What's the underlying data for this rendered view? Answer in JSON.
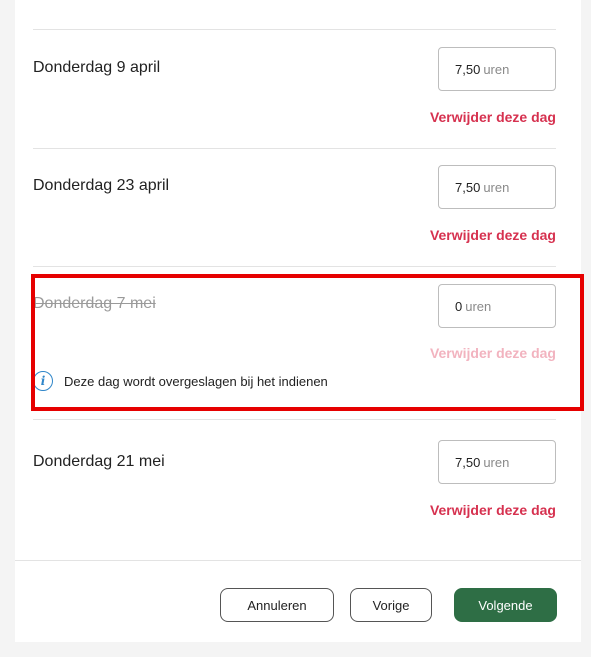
{
  "days": [
    {
      "label": "Donderdag 9 april",
      "hours_value": "7,50",
      "hours_unit": "uren",
      "remove_label": "Verwijder deze dag",
      "skipped": false
    },
    {
      "label": "Donderdag 23 april",
      "hours_value": "7,50",
      "hours_unit": "uren",
      "remove_label": "Verwijder deze dag",
      "skipped": false
    },
    {
      "label": "Donderdag 7 mei",
      "hours_value": "0",
      "hours_unit": "uren",
      "remove_label": "Verwijder deze dag",
      "skipped": true,
      "info": "Deze dag wordt overgeslagen bij het indienen"
    },
    {
      "label": "Donderdag 21 mei",
      "hours_value": "7,50",
      "hours_unit": "uren",
      "remove_label": "Verwijder deze dag",
      "skipped": false
    }
  ],
  "footer": {
    "cancel_label": "Annuleren",
    "previous_label": "Vorige",
    "next_label": "Volgende"
  },
  "colors": {
    "remove_link": "#d6314f",
    "remove_link_disabled": "#f2b3bf",
    "primary_button": "#2e6e45",
    "info_icon": "#2f86c9",
    "highlight_border": "#e60000"
  },
  "icons": {
    "info": "info-circle-icon"
  }
}
